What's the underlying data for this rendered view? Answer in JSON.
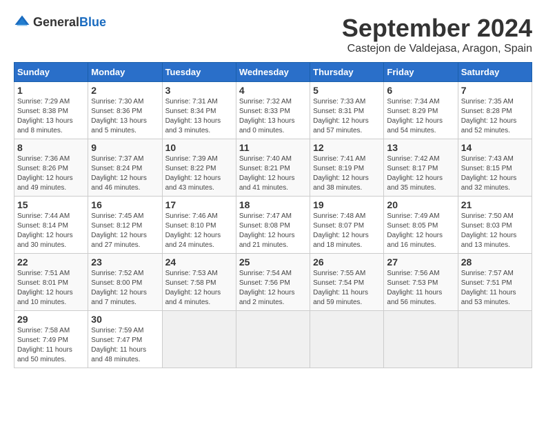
{
  "logo": {
    "general": "General",
    "blue": "Blue"
  },
  "calendar": {
    "title": "September 2024",
    "subtitle": "Castejon de Valdejasa, Aragon, Spain",
    "days_of_week": [
      "Sunday",
      "Monday",
      "Tuesday",
      "Wednesday",
      "Thursday",
      "Friday",
      "Saturday"
    ],
    "weeks": [
      [
        {
          "day": "1",
          "sunrise": "7:29 AM",
          "sunset": "8:38 PM",
          "daylight": "13 hours and 8 minutes."
        },
        {
          "day": "2",
          "sunrise": "7:30 AM",
          "sunset": "8:36 PM",
          "daylight": "13 hours and 5 minutes."
        },
        {
          "day": "3",
          "sunrise": "7:31 AM",
          "sunset": "8:34 PM",
          "daylight": "13 hours and 3 minutes."
        },
        {
          "day": "4",
          "sunrise": "7:32 AM",
          "sunset": "8:33 PM",
          "daylight": "13 hours and 0 minutes."
        },
        {
          "day": "5",
          "sunrise": "7:33 AM",
          "sunset": "8:31 PM",
          "daylight": "12 hours and 57 minutes."
        },
        {
          "day": "6",
          "sunrise": "7:34 AM",
          "sunset": "8:29 PM",
          "daylight": "12 hours and 54 minutes."
        },
        {
          "day": "7",
          "sunrise": "7:35 AM",
          "sunset": "8:28 PM",
          "daylight": "12 hours and 52 minutes."
        }
      ],
      [
        {
          "day": "8",
          "sunrise": "7:36 AM",
          "sunset": "8:26 PM",
          "daylight": "12 hours and 49 minutes."
        },
        {
          "day": "9",
          "sunrise": "7:37 AM",
          "sunset": "8:24 PM",
          "daylight": "12 hours and 46 minutes."
        },
        {
          "day": "10",
          "sunrise": "7:39 AM",
          "sunset": "8:22 PM",
          "daylight": "12 hours and 43 minutes."
        },
        {
          "day": "11",
          "sunrise": "7:40 AM",
          "sunset": "8:21 PM",
          "daylight": "12 hours and 41 minutes."
        },
        {
          "day": "12",
          "sunrise": "7:41 AM",
          "sunset": "8:19 PM",
          "daylight": "12 hours and 38 minutes."
        },
        {
          "day": "13",
          "sunrise": "7:42 AM",
          "sunset": "8:17 PM",
          "daylight": "12 hours and 35 minutes."
        },
        {
          "day": "14",
          "sunrise": "7:43 AM",
          "sunset": "8:15 PM",
          "daylight": "12 hours and 32 minutes."
        }
      ],
      [
        {
          "day": "15",
          "sunrise": "7:44 AM",
          "sunset": "8:14 PM",
          "daylight": "12 hours and 30 minutes."
        },
        {
          "day": "16",
          "sunrise": "7:45 AM",
          "sunset": "8:12 PM",
          "daylight": "12 hours and 27 minutes."
        },
        {
          "day": "17",
          "sunrise": "7:46 AM",
          "sunset": "8:10 PM",
          "daylight": "12 hours and 24 minutes."
        },
        {
          "day": "18",
          "sunrise": "7:47 AM",
          "sunset": "8:08 PM",
          "daylight": "12 hours and 21 minutes."
        },
        {
          "day": "19",
          "sunrise": "7:48 AM",
          "sunset": "8:07 PM",
          "daylight": "12 hours and 18 minutes."
        },
        {
          "day": "20",
          "sunrise": "7:49 AM",
          "sunset": "8:05 PM",
          "daylight": "12 hours and 16 minutes."
        },
        {
          "day": "21",
          "sunrise": "7:50 AM",
          "sunset": "8:03 PM",
          "daylight": "12 hours and 13 minutes."
        }
      ],
      [
        {
          "day": "22",
          "sunrise": "7:51 AM",
          "sunset": "8:01 PM",
          "daylight": "12 hours and 10 minutes."
        },
        {
          "day": "23",
          "sunrise": "7:52 AM",
          "sunset": "8:00 PM",
          "daylight": "12 hours and 7 minutes."
        },
        {
          "day": "24",
          "sunrise": "7:53 AM",
          "sunset": "7:58 PM",
          "daylight": "12 hours and 4 minutes."
        },
        {
          "day": "25",
          "sunrise": "7:54 AM",
          "sunset": "7:56 PM",
          "daylight": "12 hours and 2 minutes."
        },
        {
          "day": "26",
          "sunrise": "7:55 AM",
          "sunset": "7:54 PM",
          "daylight": "11 hours and 59 minutes."
        },
        {
          "day": "27",
          "sunrise": "7:56 AM",
          "sunset": "7:53 PM",
          "daylight": "11 hours and 56 minutes."
        },
        {
          "day": "28",
          "sunrise": "7:57 AM",
          "sunset": "7:51 PM",
          "daylight": "11 hours and 53 minutes."
        }
      ],
      [
        {
          "day": "29",
          "sunrise": "7:58 AM",
          "sunset": "7:49 PM",
          "daylight": "11 hours and 50 minutes."
        },
        {
          "day": "30",
          "sunrise": "7:59 AM",
          "sunset": "7:47 PM",
          "daylight": "11 hours and 48 minutes."
        },
        null,
        null,
        null,
        null,
        null
      ]
    ]
  }
}
